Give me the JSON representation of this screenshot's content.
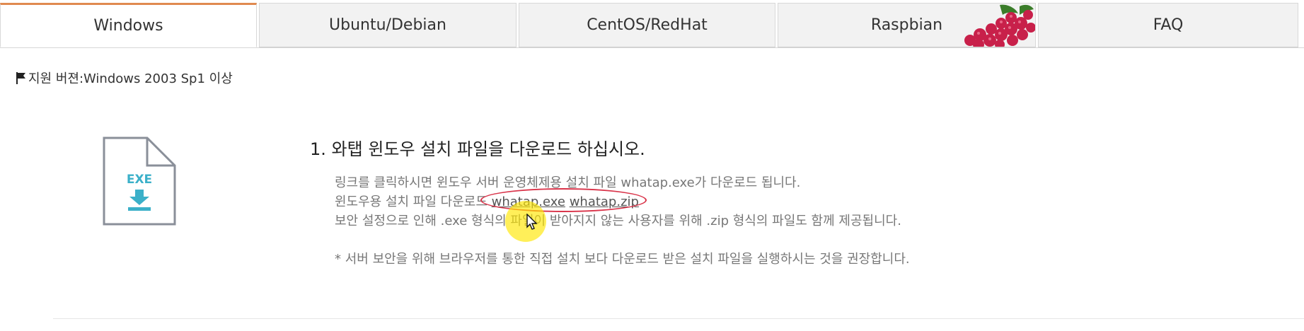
{
  "tabs": [
    {
      "label": "Windows",
      "active": true
    },
    {
      "label": "Ubuntu/Debian",
      "active": false
    },
    {
      "label": "CentOS/RedHat",
      "active": false
    },
    {
      "label": "Raspbian",
      "active": false
    },
    {
      "label": "FAQ",
      "active": false
    }
  ],
  "support": {
    "icon": "flag-icon",
    "text": "지원 버젼:Windows 2003 Sp1 이상"
  },
  "file_icon": {
    "icon": "exe-file-download-icon",
    "label": "EXE"
  },
  "step": {
    "title": "1. 와탭 윈도우 설치 파일을 다운로드 하십시오.",
    "line1": "링크를 클릭하시면 윈도우 서버 운영체제용 설치 파일 whatap.exe가 다운로드 됩니다.",
    "line2_prefix": "윈도우용 설치 파일 다운로드",
    "link_exe": "whatap.exe",
    "link_zip": "whatap.zip",
    "line3": "보안 설정으로 인해 .exe 형식의 파일이 받아지지 않는 사용자를 위해 .zip 형식의 파일도 함께 제공됩니다.",
    "note": "* 서버 보안을 위해 브라우저를 통한 직접 설치 보다 다운로드 받은 설치 파일을 실행하시는 것을 권장합니다."
  },
  "colors": {
    "active_tab_accent": "#e08a50",
    "annotation_circle": "#d9344a",
    "cursor_highlight": "#ffe600",
    "icon_accent": "#3bb0c9"
  }
}
